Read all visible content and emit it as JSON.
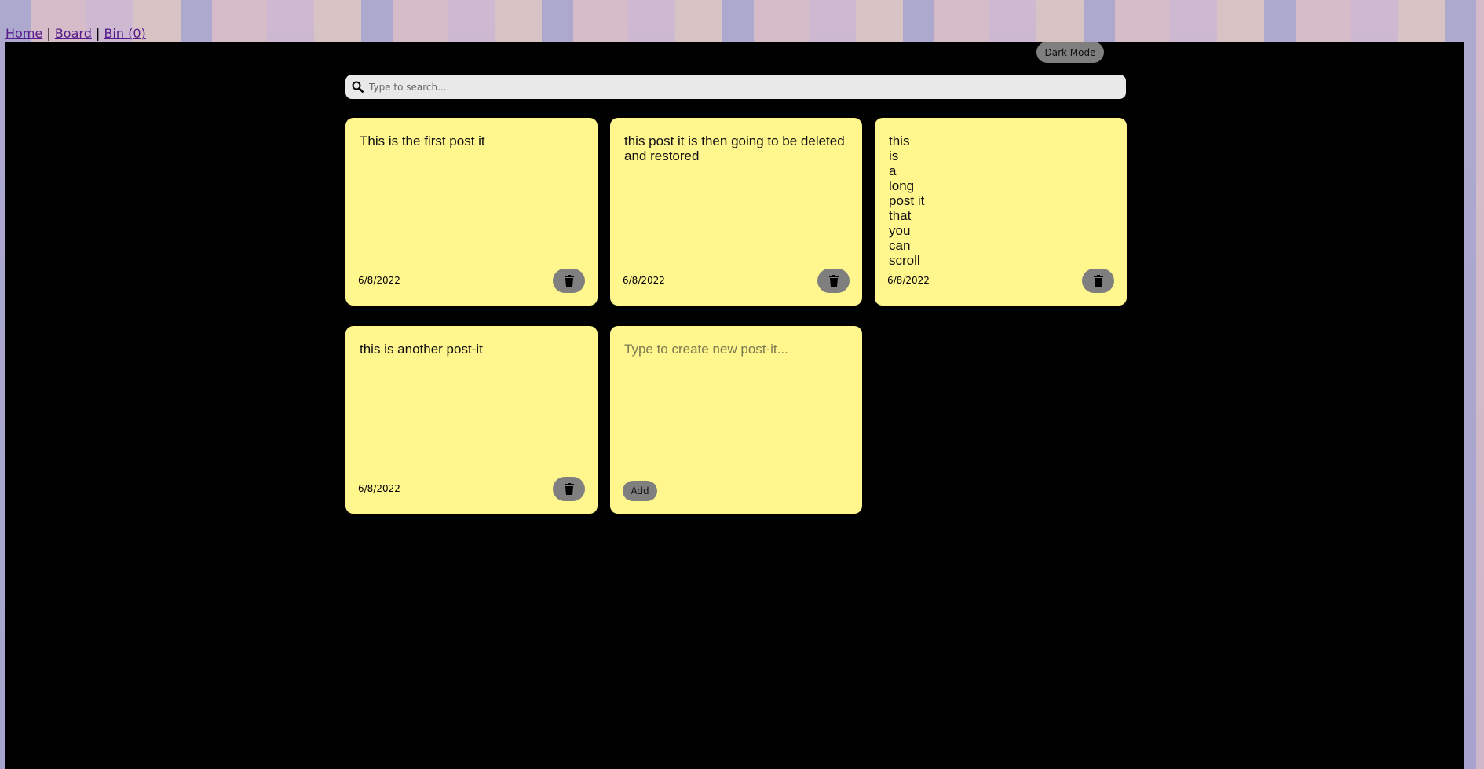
{
  "nav": {
    "home": "Home",
    "sep1": "|",
    "board": "Board",
    "sep2": "|",
    "bin": "Bin (0)"
  },
  "toolbar": {
    "dark_mode_label": "Dark Mode"
  },
  "search": {
    "placeholder": "Type to search...",
    "value": ""
  },
  "notes": [
    {
      "text": "This is the first post it",
      "date": "6/8/2022"
    },
    {
      "text": "this post it is then going to be deleted and restored",
      "date": "6/8/2022"
    },
    {
      "text": "this\nis\na\nlong\npost it\nthat\nyou\ncan\nscroll",
      "date": "6/8/2022"
    },
    {
      "text": "this is another post-it",
      "date": "6/8/2022"
    }
  ],
  "new_note": {
    "placeholder": "Type to create new post-it...",
    "add_label": "Add"
  },
  "colors": {
    "note": "#fff68e",
    "panel": "#000000",
    "button": "#7f7f7f"
  }
}
